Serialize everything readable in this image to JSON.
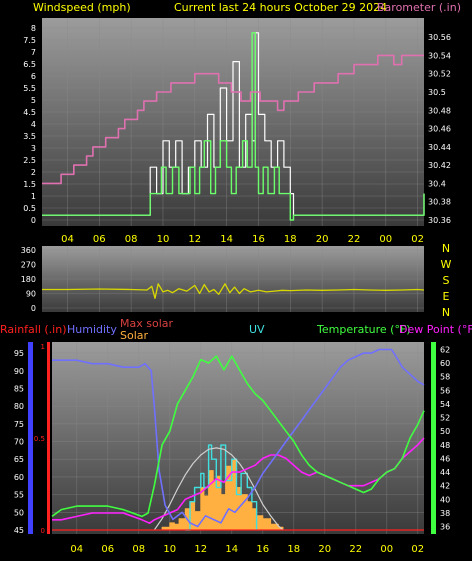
{
  "colors": {
    "background": "#000000",
    "panel_top": "#9a9a9a",
    "panel_bottom": "#3c3c3c",
    "grid": "#8a8a8a",
    "title_yellow": "#ffff00",
    "barometer_pink": "#e070b0",
    "wind_avg_green": "#6cff6c",
    "wind_gust_white": "#ffffff",
    "direction_yellow": "#d8d800",
    "rain_red": "#ff2020",
    "humidity_blue": "#7070ff",
    "max_solar_red": "#d84040",
    "solar_orange": "#ffb040",
    "uv_cyan": "#40e0e0",
    "temp_green": "#40ff40",
    "dewpoint_magenta": "#ff20ff",
    "axis_blue": "#4040ff",
    "axis_green": "#40ff40"
  },
  "header": {
    "left_title": "Windspeed (mph)",
    "center_title": "Current last 24 hours October 29 2024",
    "right_title": "Barometer (.in)"
  },
  "bottom_labels": {
    "rainfall": "Rainfall (.in)",
    "humidity": "Humidity",
    "max_solar": "Max solar",
    "solar": "Solar",
    "uv": "UV",
    "temperature": "Temperature (°F)",
    "dew_point": "Dew Point (°F)"
  },
  "chart_data": [
    {
      "type": "line",
      "x_ticks": [
        "04",
        "06",
        "08",
        "10",
        "12",
        "14",
        "16",
        "18",
        "20",
        "22",
        "00",
        "02"
      ],
      "left_axis": {
        "ticks": [
          "0",
          "0.5",
          "1",
          "1.5",
          "2",
          "2.5",
          "3",
          "3.5",
          "4",
          "4.5",
          "5",
          "5.5",
          "6",
          "6.5",
          "7",
          "7.5",
          "8"
        ],
        "ylim": [
          0,
          8
        ]
      },
      "right_axis": {
        "ticks": [
          "30.36",
          "30.38",
          "30.4",
          "30.42",
          "30.44",
          "30.46",
          "30.48",
          "30.5",
          "30.52",
          "30.54",
          "30.56"
        ],
        "ylim": [
          30.36,
          30.57
        ]
      },
      "series": [
        {
          "name": "Barometer (.in)",
          "axis": "right",
          "x": [
            2.4,
            3.0,
            3.3,
            3.6,
            4.0,
            4.4,
            4.8,
            5.2,
            5.6,
            6.0,
            6.4,
            6.8,
            7.2,
            7.6,
            8.0,
            8.4,
            8.8,
            9.2,
            9.6,
            10.0,
            10.5,
            11.0,
            11.5,
            12.0,
            12.5,
            13.0,
            13.5,
            14.0,
            14.3,
            14.6,
            14.9,
            15.2,
            15.5,
            15.8,
            16.1,
            16.4,
            16.8,
            17.2,
            17.6,
            18.0,
            18.5,
            19.0,
            19.5,
            20.0,
            20.5,
            21.0,
            21.5,
            22.0,
            22.5,
            23.0,
            23.5,
            24.0,
            24.5,
            25.0,
            25.5,
            26.0,
            26.4
          ],
          "values": [
            30.4,
            30.4,
            30.4,
            30.41,
            30.41,
            30.42,
            30.42,
            30.43,
            30.44,
            30.44,
            30.45,
            30.45,
            30.46,
            30.47,
            30.47,
            30.48,
            30.49,
            30.49,
            30.5,
            30.5,
            30.51,
            30.51,
            30.51,
            30.52,
            30.52,
            30.52,
            30.51,
            30.51,
            30.5,
            30.5,
            30.49,
            30.49,
            30.5,
            30.5,
            30.49,
            30.49,
            30.49,
            30.48,
            30.49,
            30.49,
            30.5,
            30.5,
            30.51,
            30.51,
            30.51,
            30.52,
            30.52,
            30.53,
            30.53,
            30.53,
            30.54,
            30.54,
            30.53,
            30.54,
            30.54,
            30.54,
            30.54
          ]
        },
        {
          "name": "Wind average",
          "axis": "left",
          "x": [
            2.4,
            6.0,
            9.0,
            9.2,
            9.5,
            9.9,
            10.2,
            10.6,
            11.0,
            11.3,
            11.7,
            12.0,
            12.3,
            12.6,
            13.0,
            13.3,
            13.6,
            14.0,
            14.3,
            14.6,
            15.0,
            15.3,
            15.6,
            15.8,
            16.0,
            16.3,
            16.6,
            17.0,
            17.3,
            17.6,
            18.0,
            18.2,
            20.0,
            24.0,
            26.2,
            26.4
          ],
          "values": [
            0.2,
            0.2,
            0.2,
            1.1,
            1.1,
            2.2,
            1.1,
            2.2,
            1.1,
            1.1,
            2.2,
            1.1,
            2.2,
            3.3,
            1.1,
            2.2,
            3.3,
            2.2,
            1.1,
            2.2,
            3.3,
            2.2,
            7.8,
            2.2,
            1.1,
            2.2,
            1.1,
            2.2,
            1.1,
            1.1,
            0.0,
            0.2,
            0.2,
            0.2,
            0.2,
            1.1
          ]
        },
        {
          "name": "Wind gust",
          "axis": "left",
          "x": [
            2.4,
            6.0,
            9.0,
            9.2,
            9.6,
            10.0,
            10.4,
            10.8,
            11.2,
            11.6,
            12.0,
            12.4,
            12.8,
            13.2,
            13.6,
            14.0,
            14.4,
            14.8,
            15.2,
            15.6,
            15.8,
            16.0,
            16.4,
            16.8,
            17.2,
            17.6,
            18.0,
            18.2,
            20.0,
            26.2,
            26.4
          ],
          "values": [
            0.2,
            0.2,
            0.2,
            2.2,
            1.1,
            3.3,
            2.2,
            3.3,
            1.1,
            2.2,
            3.3,
            2.2,
            4.4,
            2.2,
            5.5,
            3.3,
            6.6,
            2.2,
            4.4,
            3.3,
            7.8,
            4.4,
            3.3,
            2.2,
            3.3,
            2.2,
            1.1,
            0.2,
            0.2,
            0.2,
            1.1
          ]
        }
      ]
    },
    {
      "type": "line",
      "x_ticks": [
        "04",
        "06",
        "08",
        "10",
        "12",
        "14",
        "16",
        "18",
        "20",
        "22",
        "00",
        "02"
      ],
      "left_axis": {
        "ticks": [
          "0",
          "90",
          "180",
          "270",
          "360"
        ],
        "ylim": [
          0,
          360
        ]
      },
      "right_axis": {
        "ticks": [
          "N",
          "W",
          "S",
          "E",
          "N"
        ]
      },
      "series": [
        {
          "name": "Wind direction",
          "x": [
            2.4,
            4,
            6,
            8,
            9.0,
            9.3,
            9.5,
            9.7,
            10.0,
            10.3,
            10.6,
            11,
            11.5,
            12,
            12.3,
            12.6,
            12.9,
            13.2,
            13.5,
            13.9,
            14.2,
            14.5,
            14.8,
            15.1,
            15.5,
            16,
            16.5,
            17,
            17.5,
            18,
            19,
            20,
            21,
            22,
            23,
            24,
            25,
            26,
            26.4
          ],
          "values": [
            115,
            115,
            118,
            115,
            112,
            135,
            60,
            150,
            100,
            110,
            95,
            120,
            105,
            140,
            90,
            145,
            100,
            115,
            85,
            150,
            95,
            130,
            90,
            120,
            100,
            110,
            100,
            105,
            110,
            108,
            112,
            110,
            112,
            115,
            112,
            110,
            112,
            115,
            112
          ]
        }
      ]
    },
    {
      "type": "line",
      "x_ticks": [
        "04",
        "06",
        "08",
        "10",
        "12",
        "14",
        "16",
        "18",
        "20",
        "22",
        "00",
        "02"
      ],
      "humidity_axis": {
        "ticks": [
          "45",
          "50",
          "55",
          "60",
          "65",
          "70",
          "75",
          "80",
          "85",
          "90",
          "95"
        ],
        "ylim": [
          45,
          97
        ]
      },
      "temperature_axis": {
        "ticks": [
          "36",
          "38",
          "40",
          "42",
          "44",
          "46",
          "48",
          "50",
          "52",
          "54",
          "56",
          "58",
          "60",
          "62"
        ],
        "ylim": [
          35.5,
          62.5
        ]
      },
      "rain_axis": {
        "ticks": [
          "0",
          "0.5",
          "1"
        ],
        "ylim": [
          0,
          1
        ]
      },
      "series": [
        {
          "name": "Humidity",
          "axis": "humidity",
          "x": [
            2.4,
            3,
            4,
            5,
            6,
            7,
            7.6,
            8,
            8.4,
            8.8,
            9.0,
            9.3,
            9.7,
            10.2,
            10.8,
            11.3,
            11.8,
            12.3,
            12.8,
            13.3,
            13.8,
            14.2,
            14.6,
            15.0,
            15.5,
            16,
            16.5,
            17,
            17.5,
            18,
            18.5,
            19,
            19.5,
            20,
            20.5,
            21,
            21.5,
            22,
            22.5,
            23,
            23.5,
            24,
            24.3,
            24.6,
            25,
            25.5,
            26,
            26.4
          ],
          "values": [
            93,
            93,
            93,
            92,
            92,
            91,
            91,
            91,
            92,
            90,
            80,
            62,
            52,
            48,
            50,
            47,
            46,
            49,
            48,
            47,
            51,
            50,
            52,
            54,
            57,
            61,
            64,
            67,
            70,
            73,
            76,
            79,
            82,
            85,
            88,
            91,
            93,
            94,
            95,
            95,
            96,
            96,
            96,
            94,
            91,
            89,
            87,
            86
          ]
        },
        {
          "name": "Temperature (°F)",
          "axis": "temperature",
          "x": [
            2.4,
            3,
            4,
            5,
            6,
            7,
            7.6,
            8.2,
            8.6,
            9.0,
            9.5,
            10,
            10.5,
            11,
            11.5,
            12,
            12.5,
            13,
            13.5,
            14,
            14.5,
            15,
            15.5,
            16,
            16.5,
            17,
            17.5,
            18,
            18.5,
            19,
            19.5,
            20,
            20.5,
            21,
            21.5,
            22,
            22.5,
            23,
            23.5,
            24,
            24.5,
            25,
            25.5,
            26,
            26.4
          ],
          "values": [
            37.5,
            38.5,
            39,
            39,
            39,
            38.5,
            38,
            37.5,
            38,
            42,
            48,
            50,
            54,
            56,
            58,
            60.5,
            60,
            61,
            59,
            61,
            59,
            57,
            55.5,
            54.5,
            53,
            51.5,
            50,
            48.5,
            46.5,
            45,
            44,
            43.5,
            43,
            42.5,
            42,
            41.5,
            41,
            41.5,
            43,
            44,
            44.5,
            46,
            49,
            51,
            53
          ]
        },
        {
          "name": "Dew Point (°F)",
          "axis": "temperature",
          "x": [
            2.4,
            3,
            4,
            5,
            6,
            7,
            7.6,
            8.2,
            8.7,
            9.0,
            9.5,
            10,
            10.5,
            11,
            11.5,
            12,
            12.5,
            13,
            13.5,
            14,
            14.5,
            15,
            15.5,
            16,
            16.5,
            17,
            17.5,
            18,
            18.5,
            19,
            19.5,
            20,
            20.5,
            21,
            21.5,
            22,
            22.5,
            23,
            23.5,
            24,
            24.5,
            25,
            25.5,
            26,
            26.4
          ],
          "values": [
            37,
            37,
            37.5,
            38,
            38,
            38,
            37.5,
            37,
            36.5,
            37,
            37.5,
            38,
            38.5,
            40,
            40.5,
            41,
            42,
            43,
            42.5,
            44,
            44,
            44.5,
            45,
            46,
            46.5,
            46.5,
            46,
            45,
            44,
            43.5,
            44,
            43.5,
            43,
            42.5,
            42,
            42,
            42,
            42.5,
            43,
            44,
            44.5,
            46,
            47,
            48,
            49
          ]
        },
        {
          "name": "Max solar",
          "axis": "solar",
          "x": [
            9.0,
            9.5,
            10,
            10.5,
            11,
            11.5,
            12,
            12.5,
            13,
            13.5,
            14,
            14.5,
            15,
            15.5,
            16,
            16.5,
            17,
            17.3
          ],
          "values": [
            0,
            80,
            180,
            290,
            390,
            470,
            530,
            570,
            580,
            570,
            530,
            470,
            390,
            290,
            180,
            100,
            30,
            0
          ]
        },
        {
          "name": "Solar",
          "axis": "solar",
          "x": [
            9.0,
            9.5,
            10,
            10.3,
            10.6,
            11,
            11.3,
            11.6,
            12,
            12.2,
            12.5,
            12.8,
            13,
            13.3,
            13.6,
            14,
            14.3,
            14.6,
            15,
            15.3,
            15.6,
            16,
            16.5,
            17,
            17.3
          ],
          "values": [
            0,
            20,
            50,
            40,
            80,
            150,
            200,
            130,
            300,
            240,
            420,
            350,
            380,
            250,
            450,
            500,
            300,
            250,
            200,
            150,
            100,
            80,
            40,
            20,
            0
          ]
        },
        {
          "name": "UV",
          "axis": "solar",
          "x": [
            11,
            11.3,
            11.6,
            12,
            12.2,
            12.5,
            12.7,
            13,
            13.3,
            13.6,
            14,
            14.3,
            14.6,
            15,
            15.3,
            15.6
          ],
          "values": [
            0,
            200,
            300,
            400,
            300,
            600,
            500,
            300,
            600,
            350,
            500,
            250,
            400,
            300,
            200,
            0
          ]
        },
        {
          "name": "Rainfall (.in)",
          "axis": "rain",
          "x": [
            2.4,
            26.4
          ],
          "values": [
            0,
            0
          ]
        }
      ]
    }
  ]
}
